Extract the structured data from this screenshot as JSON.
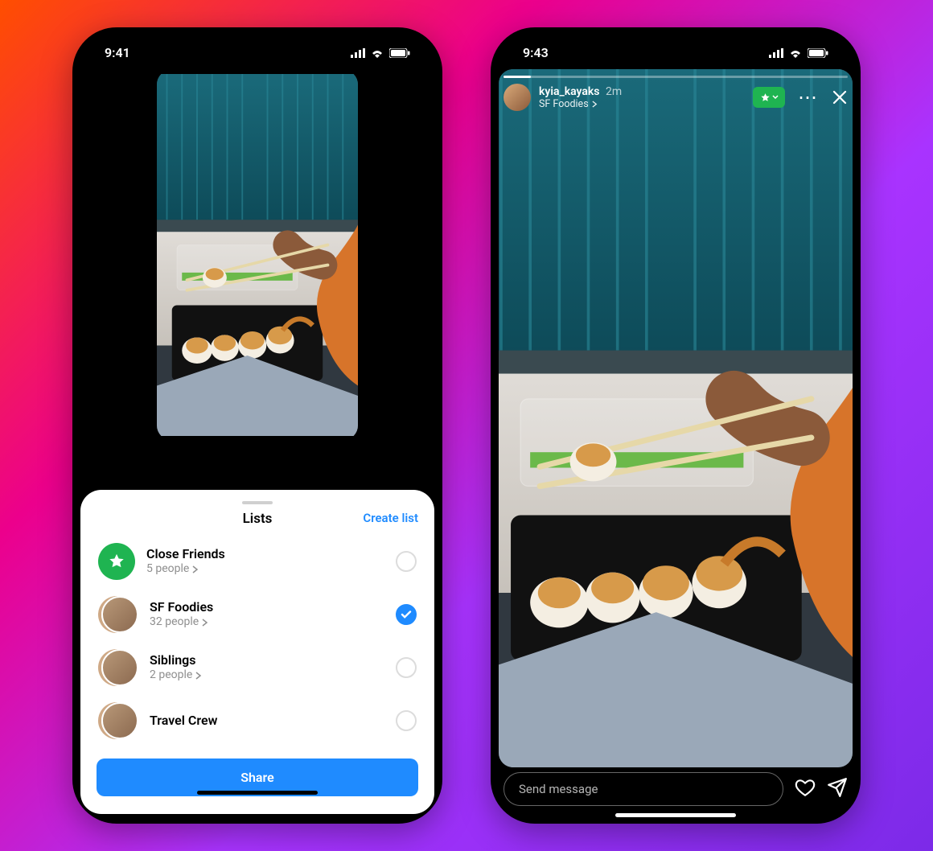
{
  "left": {
    "time": "9:41",
    "sheet_title": "Lists",
    "create_list": "Create list",
    "lists": [
      {
        "name": "Close Friends",
        "sub": "5 people",
        "selected": false,
        "kind": "close_friends"
      },
      {
        "name": "SF Foodies",
        "sub": "32 people",
        "selected": true,
        "kind": "group"
      },
      {
        "name": "Siblings",
        "sub": "2 people",
        "selected": false,
        "kind": "group"
      },
      {
        "name": "Travel Crew",
        "sub": "",
        "selected": false,
        "kind": "group"
      }
    ],
    "share_label": "Share"
  },
  "right": {
    "time": "9:43",
    "username": "kyia_kayaks",
    "timestamp": "2m",
    "list_name": "SF Foodies",
    "message_placeholder": "Send message"
  }
}
